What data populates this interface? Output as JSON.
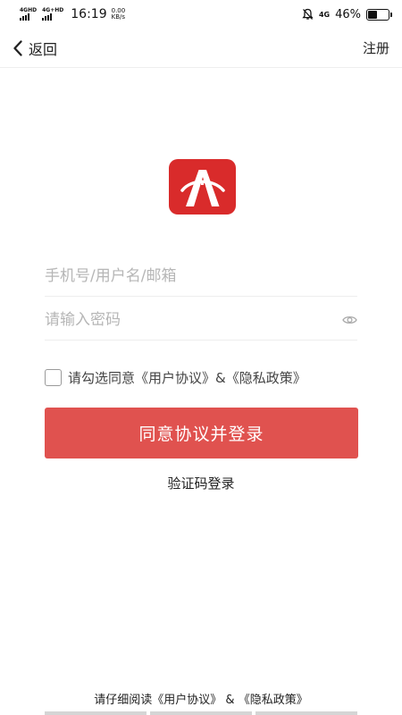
{
  "status_bar": {
    "signal_1": "4GHD",
    "signal_2": "4G+HD",
    "time": "16:19",
    "net_speed_value": "0.00",
    "net_speed_unit": "KB/s",
    "mute_icon": "bell-off-icon",
    "network": "4G",
    "battery_percent": "46%",
    "battery_level": 0.46
  },
  "nav": {
    "back_label": "返回",
    "register_label": "注册"
  },
  "login_form": {
    "account_placeholder": "手机号/用户名/邮箱",
    "account_value": "",
    "password_placeholder": "请输入密码",
    "password_value": "",
    "agree_prefix": "请勾选同意",
    "user_agreement": "《用户协议》",
    "and": "&",
    "privacy_policy": "《隐私政策》",
    "submit_label": "同意协议并登录",
    "sms_login_label": "验证码登录"
  },
  "footer": {
    "prefix": "请仔细阅读",
    "user_agreement": "《用户协议》",
    "and": " & ",
    "privacy_policy": "《隐私政策》"
  },
  "colors": {
    "primary_button": "#e0524f",
    "logo_red": "#d92b2b",
    "placeholder": "#b6b6b6"
  }
}
